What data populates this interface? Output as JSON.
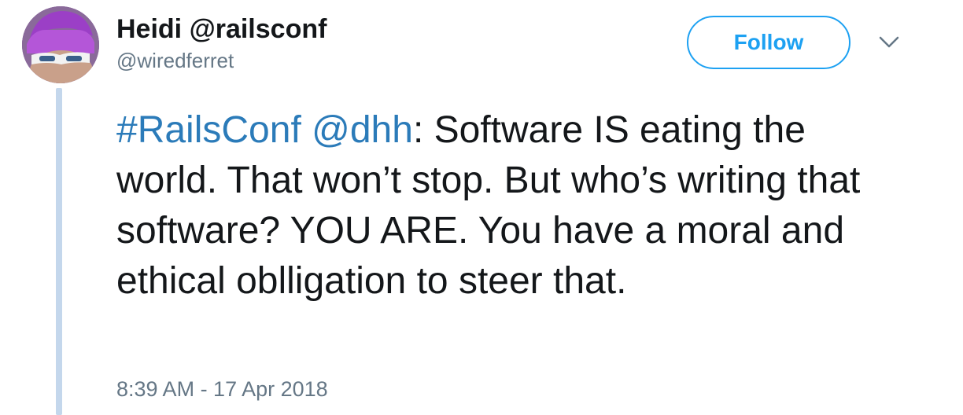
{
  "author": {
    "display_name": "Heidi @railsconf",
    "handle": "@wiredferret"
  },
  "actions": {
    "follow_label": "Follow",
    "more_icon": "chevron-down-icon"
  },
  "tweet": {
    "hashtag": "#RailsConf",
    "space": " ",
    "mention": "@dhh",
    "body_line1": ": Software IS eating the",
    "body_rest": "world. That won’t stop. But who’s writing that software? YOU ARE. You have a moral and ethical oblligation to steer that.",
    "timestamp": "8:39 AM - 17 Apr 2018"
  },
  "colors": {
    "link": "#2b7bb9",
    "follow_accent": "#1da1f2",
    "thread_line": "#c4d7ec",
    "secondary_text": "#657786"
  }
}
